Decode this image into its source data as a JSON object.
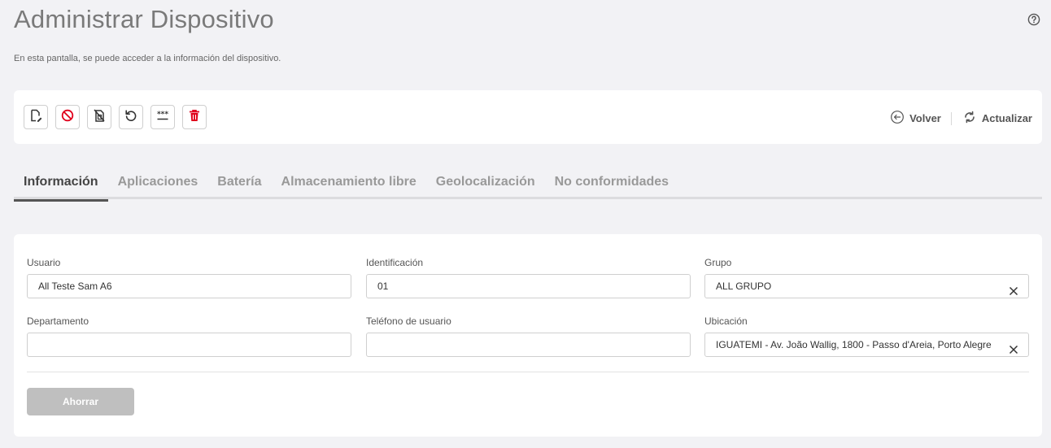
{
  "page": {
    "title": "Administrar Dispositivo",
    "subtitle": "En esta pantalla, se puede acceder a la información del dispositivo."
  },
  "toolbar": {
    "buttons": [
      {
        "icon": "edit-document-icon"
      },
      {
        "icon": "block-icon",
        "color": "#e0001b"
      },
      {
        "icon": "no-sim-icon"
      },
      {
        "icon": "reset-icon"
      },
      {
        "icon": "password-icon"
      },
      {
        "icon": "trash-icon",
        "color": "#e0001b"
      }
    ],
    "back_label": "Volver",
    "refresh_label": "Actualizar"
  },
  "tabs": [
    {
      "label": "Información",
      "active": true
    },
    {
      "label": "Aplicaciones",
      "active": false
    },
    {
      "label": "Batería",
      "active": false
    },
    {
      "label": "Almacenamiento libre",
      "active": false
    },
    {
      "label": "Geolocalización",
      "active": false
    },
    {
      "label": "No conformidades",
      "active": false
    }
  ],
  "form": {
    "usuario": {
      "label": "Usuario",
      "value": "All Teste Sam A6"
    },
    "identificacion": {
      "label": "Identificación",
      "value": "01"
    },
    "grupo": {
      "label": "Grupo",
      "value": "ALL GRUPO"
    },
    "departamento": {
      "label": "Departamento",
      "value": ""
    },
    "telefono": {
      "label": "Teléfono de usuario",
      "value": ""
    },
    "ubicacion": {
      "label": "Ubicación",
      "value": "IGUATEMI - Av. João Wallig, 1800 - Passo d'Areia, Porto Alegre"
    },
    "save_label": "Ahorrar"
  },
  "colors": {
    "accent_red": "#e0001b",
    "disabled_button": "#bfbfbf",
    "background": "#f2f2f5"
  }
}
